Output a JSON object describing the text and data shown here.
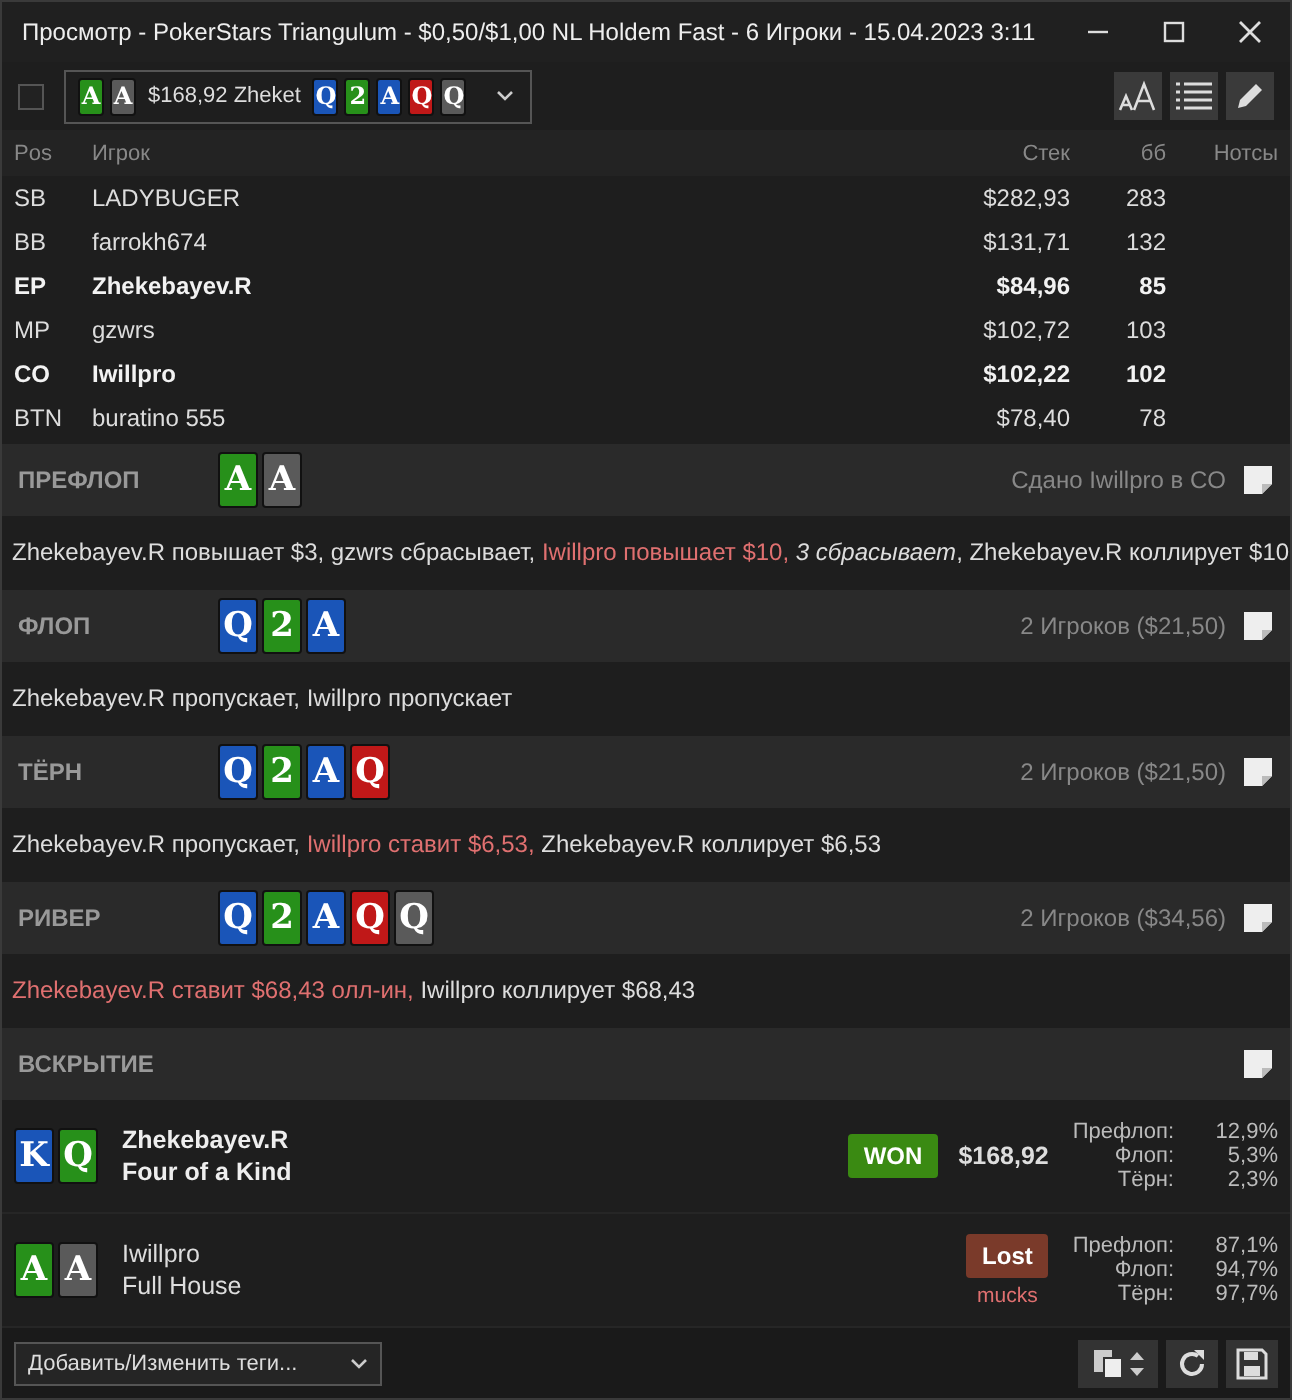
{
  "window": {
    "title": "Просмотр - PokerStars Triangulum - $0,50/$1,00 NL Holdem Fast - 6 Игроки - 15.04.2023 3:11"
  },
  "toolbar": {
    "checked": false,
    "hand_selector": {
      "hole_cards": [
        {
          "rank": "A",
          "color": "#27901a"
        },
        {
          "rank": "A",
          "color": "#5a5a5a"
        }
      ],
      "text": "$168,92 Zheket",
      "board": [
        {
          "rank": "Q",
          "color": "#1a55b8"
        },
        {
          "rank": "2",
          "color": "#27901a"
        },
        {
          "rank": "A",
          "color": "#1a55b8"
        },
        {
          "rank": "Q",
          "color": "#c01818"
        },
        {
          "rank": "Q",
          "color": "#5a5a5a"
        }
      ]
    }
  },
  "players_table": {
    "columns": [
      "Pos",
      "Игрок",
      "Стек",
      "бб",
      "Нотсы"
    ],
    "rows": [
      {
        "pos": "SB",
        "player": "LADYBUGER",
        "stack": "$282,93",
        "bb": "283",
        "bold": false
      },
      {
        "pos": "BB",
        "player": "farrokh674",
        "stack": "$131,71",
        "bb": "132",
        "bold": false
      },
      {
        "pos": "EP",
        "player": "Zhekebayev.R",
        "stack": "$84,96",
        "bb": "85",
        "bold": true
      },
      {
        "pos": "MP",
        "player": "gzwrs",
        "stack": "$102,72",
        "bb": "103",
        "bold": false
      },
      {
        "pos": "CO",
        "player": "Iwillpro",
        "stack": "$102,22",
        "bb": "102",
        "bold": true
      },
      {
        "pos": "BTN",
        "player": "buratino 555",
        "stack": "$78,40",
        "bb": "78",
        "bold": false
      }
    ]
  },
  "streets": [
    {
      "name": "ПРЕФЛОП",
      "cards": [
        {
          "rank": "A",
          "color": "#27901a"
        },
        {
          "rank": "A",
          "color": "#5a5a5a"
        }
      ],
      "info": "Сдано Iwillpro в CO",
      "actions": [
        {
          "text": "Zhekebayev.R повышает $3, gzwrs сбрасывает, ",
          "kind": "plain"
        },
        {
          "text": "Iwillpro повышает $10, ",
          "kind": "aggressive"
        },
        {
          "text": "3 сбрасывает",
          "kind": "folded"
        },
        {
          "text": ", Zhekebayev.R коллирует $10",
          "kind": "plain"
        }
      ]
    },
    {
      "name": "ФЛОП",
      "cards": [
        {
          "rank": "Q",
          "color": "#1a55b8"
        },
        {
          "rank": "2",
          "color": "#27901a"
        },
        {
          "rank": "A",
          "color": "#1a55b8"
        }
      ],
      "info": "2 Игроков ($21,50)",
      "actions": [
        {
          "text": "Zhekebayev.R пропускает, Iwillpro пропускает",
          "kind": "plain"
        }
      ]
    },
    {
      "name": "ТЁРН",
      "cards": [
        {
          "rank": "Q",
          "color": "#1a55b8"
        },
        {
          "rank": "2",
          "color": "#27901a"
        },
        {
          "rank": "A",
          "color": "#1a55b8"
        },
        {
          "rank": "Q",
          "color": "#c01818"
        }
      ],
      "info": "2 Игроков ($21,50)",
      "actions": [
        {
          "text": "Zhekebayev.R пропускает, ",
          "kind": "plain"
        },
        {
          "text": "Iwillpro ставит $6,53, ",
          "kind": "aggressive"
        },
        {
          "text": "Zhekebayev.R коллирует $6,53",
          "kind": "plain"
        }
      ]
    },
    {
      "name": "РИВЕР",
      "cards": [
        {
          "rank": "Q",
          "color": "#1a55b8"
        },
        {
          "rank": "2",
          "color": "#27901a"
        },
        {
          "rank": "A",
          "color": "#1a55b8"
        },
        {
          "rank": "Q",
          "color": "#c01818"
        },
        {
          "rank": "Q",
          "color": "#5a5a5a"
        }
      ],
      "info": "2 Игроков ($34,56)",
      "actions": [
        {
          "text": "Zhekebayev.R ставит $68,43 олл-ин, ",
          "kind": "aggressive"
        },
        {
          "text": "Iwillpro коллирует $68,43",
          "kind": "plain"
        }
      ]
    }
  ],
  "showdown": {
    "title": "ВСКРЫТИЕ",
    "players": [
      {
        "cards": [
          {
            "rank": "K",
            "color": "#1a55b8"
          },
          {
            "rank": "Q",
            "color": "#27901a"
          }
        ],
        "name": "Zhekebayev.R",
        "hand": "Four of a Kind",
        "result": "WON",
        "kind": "won",
        "amount": "$168,92",
        "equity": [
          {
            "label": "Префлоп:",
            "value": "12,9%"
          },
          {
            "label": "Флоп:",
            "value": "5,3%"
          },
          {
            "label": "Тёрн:",
            "value": "2,3%"
          }
        ]
      },
      {
        "cards": [
          {
            "rank": "A",
            "color": "#27901a"
          },
          {
            "rank": "A",
            "color": "#5a5a5a"
          }
        ],
        "name": "Iwillpro",
        "hand": "Full House",
        "result": "Lost",
        "kind": "lost",
        "note": "mucks",
        "equity": [
          {
            "label": "Префлоп:",
            "value": "87,1%"
          },
          {
            "label": "Флоп:",
            "value": "94,7%"
          },
          {
            "label": "Тёрн:",
            "value": "97,7%"
          }
        ]
      }
    ]
  },
  "footer": {
    "tags_select": "Добавить/Изменить теги..."
  }
}
